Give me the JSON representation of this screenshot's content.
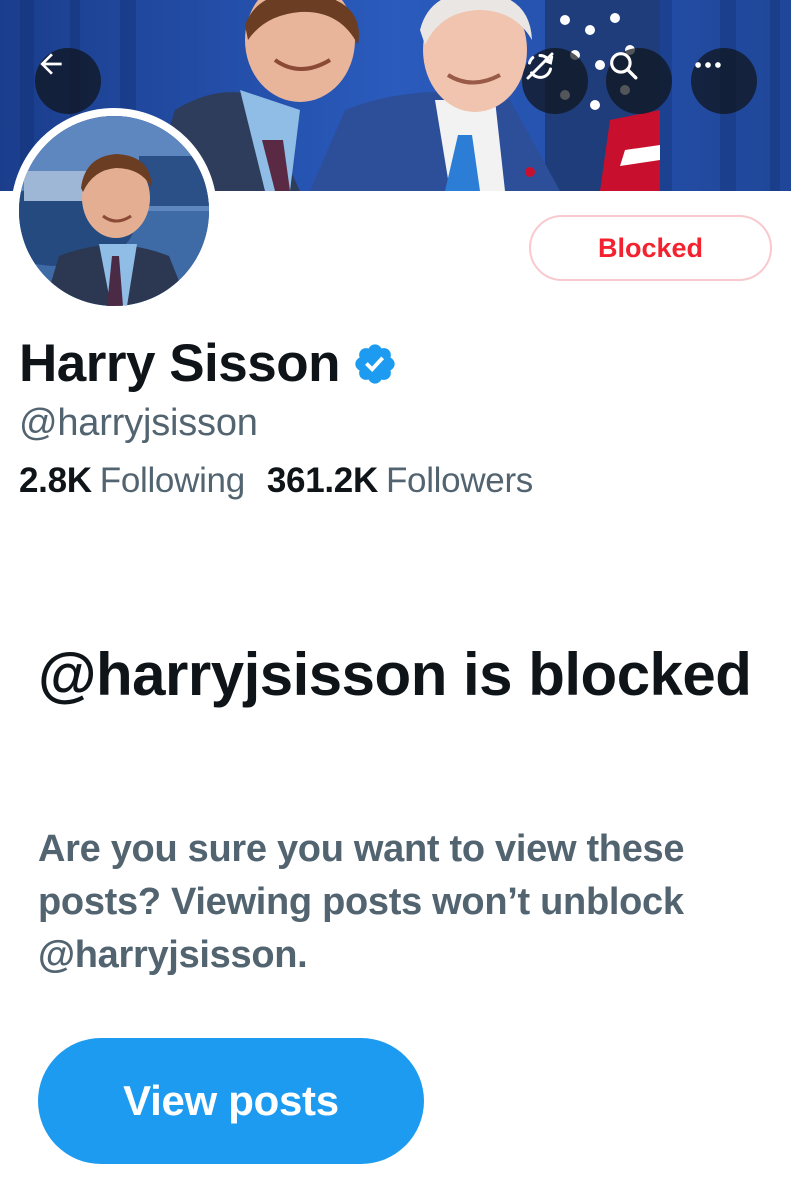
{
  "profile": {
    "display_name": "Harry Sisson",
    "handle": "@harryjsisson",
    "verified": true,
    "following_count": "2.8K",
    "following_label": "Following",
    "followers_count": "361.2K",
    "followers_label": "Followers"
  },
  "header": {
    "back_icon": "arrow-left-icon",
    "translate_icon": "no-sync-icon",
    "search_icon": "search-icon",
    "more_icon": "more-horizontal-icon"
  },
  "actions": {
    "blocked_label": "Blocked"
  },
  "notice": {
    "title": "@harryjsisson is blocked",
    "body": "Are you sure you want to view these posts? Viewing posts won’t unblock @harryjsisson.",
    "view_posts_label": "View posts"
  },
  "colors": {
    "accent": "#1d9bf0",
    "blocked_red": "#f4212e",
    "secondary_text": "#536471",
    "primary_text": "#0f1419"
  }
}
